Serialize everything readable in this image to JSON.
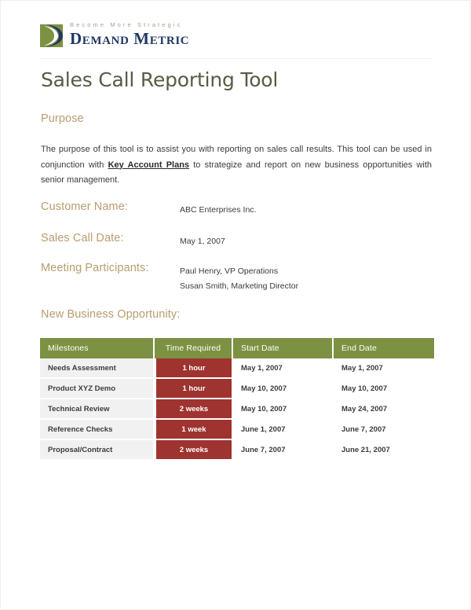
{
  "brand": {
    "tagline": "Become More Strategic",
    "name": "Demand Metric",
    "logo_icon": "demand-metric-swoosh-logo",
    "green": "#7d9142",
    "navy": "#1f3864"
  },
  "document": {
    "title": "Sales Call Reporting Tool",
    "title_color": "#585b43"
  },
  "purpose": {
    "heading": "Purpose",
    "heading_color": "#b79d6e",
    "text_before_link": "The purpose of this tool is to assist you with reporting on sales call results.  This tool can be used in conjunction with ",
    "link_text": "Key Account Plans",
    "text_after_link": " to strategize and report on new business opportunities with senior management."
  },
  "fields": {
    "customer_name": {
      "label": "Customer Name:",
      "value": "ABC Enterprises Inc."
    },
    "sales_call_date": {
      "label": "Sales Call Date:",
      "value": "May 1, 2007"
    },
    "meeting_participants": {
      "label": "Meeting Participants:",
      "value_line1": "Paul Henry, VP Operations",
      "value_line2": "Susan Smith, Marketing Director"
    }
  },
  "opportunity": {
    "heading": "New Business Opportunity:",
    "table": {
      "header_bg": "#7d9142",
      "time_cell_bg": "#9e3330",
      "milestone_cell_bg": "#f1f1f1",
      "columns": [
        "Milestones",
        "Time Required",
        "Start Date",
        "End Date"
      ],
      "rows": [
        {
          "milestone": "Needs Assessment",
          "time_required": "1 hour",
          "start_date": "May 1, 2007",
          "end_date": "May 1, 2007"
        },
        {
          "milestone": "Product XYZ Demo",
          "time_required": "1 hour",
          "start_date": "May 10, 2007",
          "end_date": "May 10, 2007"
        },
        {
          "milestone": "Technical Review",
          "time_required": "2 weeks",
          "start_date": "May 10, 2007",
          "end_date": "May 24, 2007"
        },
        {
          "milestone": "Reference Checks",
          "time_required": "1 week",
          "start_date": "June 1, 2007",
          "end_date": "June 7, 2007"
        },
        {
          "milestone": "Proposal/Contract",
          "time_required": "2 weeks",
          "start_date": "June 7, 2007",
          "end_date": "June 21, 2007"
        }
      ]
    }
  }
}
